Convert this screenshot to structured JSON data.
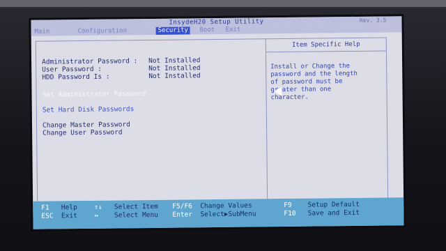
{
  "window": {
    "title": "InsydeH20 Setup Utility",
    "version": "Rev. 3.5"
  },
  "menu": [
    {
      "label": "Main",
      "active": false
    },
    {
      "label": "Configuration",
      "active": false
    },
    {
      "label": "Security",
      "active": true
    },
    {
      "label": "Boot",
      "active": false
    },
    {
      "label": "Exit",
      "active": false
    }
  ],
  "security": {
    "status": [
      {
        "label": "Administrator Password :",
        "value": "Not Installed"
      },
      {
        "label": "User Password :",
        "value": "Not Installed"
      },
      {
        "label": "HDD Password Is :",
        "value": "Not Installed"
      }
    ],
    "options": {
      "set_admin": "Set Administrator Password",
      "set_hdd": "Set Hard Disk Passwords",
      "change_master": "Change Master Password",
      "change_user": "Change User Password"
    }
  },
  "help": {
    "title": "Item Specific Help",
    "text": "Install or Change the\npassword and the length\nof password must be\ngreater than one\ncharacter."
  },
  "footer": {
    "f1": {
      "key": "F1",
      "desc": "Help"
    },
    "esc": {
      "key": "ESC",
      "desc": "Exit"
    },
    "updown": {
      "key": "↑↓",
      "desc": "Select Item"
    },
    "leftright": {
      "key": "↔",
      "desc": "Select Menu"
    },
    "f5f6": {
      "key": "F5/F6",
      "desc": "Change Values"
    },
    "enter": {
      "key": "Enter",
      "desc": "Select▶SubMenu"
    },
    "f9": {
      "key": "F9",
      "desc": "Setup Default"
    },
    "f10": {
      "key": "F10",
      "desc": "Save and Exit"
    }
  },
  "colors": {
    "screen_bg": "#dcdde6",
    "accent": "#3a52c8",
    "footer_bg": "#5ea6cf",
    "text": "#2a2f70"
  }
}
